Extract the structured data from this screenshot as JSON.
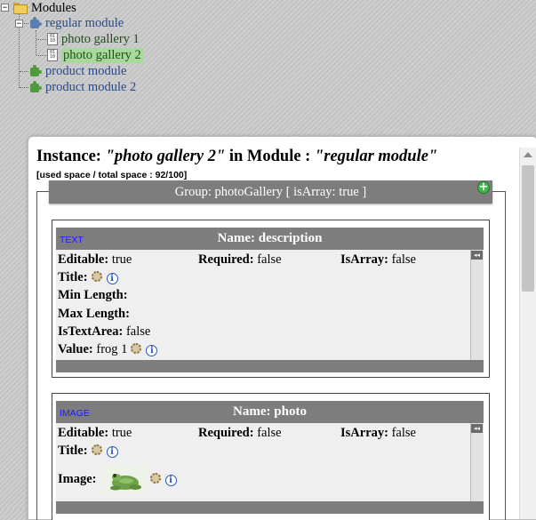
{
  "tree": {
    "root": {
      "label": "Modules",
      "icon": "folder-icon"
    },
    "modules": [
      {
        "label": "regular module",
        "icon": "puzzle-icon",
        "children": [
          {
            "label": "photo gallery 1",
            "icon": "document-icon"
          },
          {
            "label": "photo gallery 2",
            "icon": "document-icon",
            "selected": true
          }
        ]
      },
      {
        "label": "product module",
        "icon": "puzzle-icon"
      },
      {
        "label": "product module 2",
        "icon": "puzzle-icon"
      }
    ],
    "expander_minus": "−"
  },
  "instance": {
    "prefix": "Instance:",
    "name": "\"photo gallery 2\"",
    "in_module": "in Module :",
    "module": "\"regular module\"",
    "space": "[used space / total space : 92/100]"
  },
  "group": {
    "header": "Group: photoGallery [ isArray: true ]",
    "add_symbol": "+"
  },
  "fields": [
    {
      "type": "TEXT",
      "name": "Name: description",
      "editable_label": "Editable:",
      "editable": "true",
      "required_label": "Required:",
      "required": "false",
      "isarray_label": "IsArray:",
      "isarray": "false",
      "title_label": "Title:",
      "minlength_label": "Min Length:",
      "maxlength_label": "Max Length:",
      "istextarea_label": "IsTextArea:",
      "istextarea": "false",
      "value_label": "Value:",
      "value": "frog 1"
    },
    {
      "type": "IMAGE",
      "name": "Name: photo",
      "editable_label": "Editable:",
      "editable": "true",
      "required_label": "Required:",
      "required": "false",
      "isarray_label": "IsArray:",
      "isarray": "false",
      "title_label": "Title:",
      "image_label": "Image:"
    }
  ],
  "icons": {
    "info_glyph": "i",
    "collapse_glyph": "◂◂"
  },
  "colors": {
    "header_gray": "#7d7d7d",
    "type_blue": "#1a1aff",
    "selected_green": "#a9d99a",
    "add_green": "#3fb84b"
  }
}
